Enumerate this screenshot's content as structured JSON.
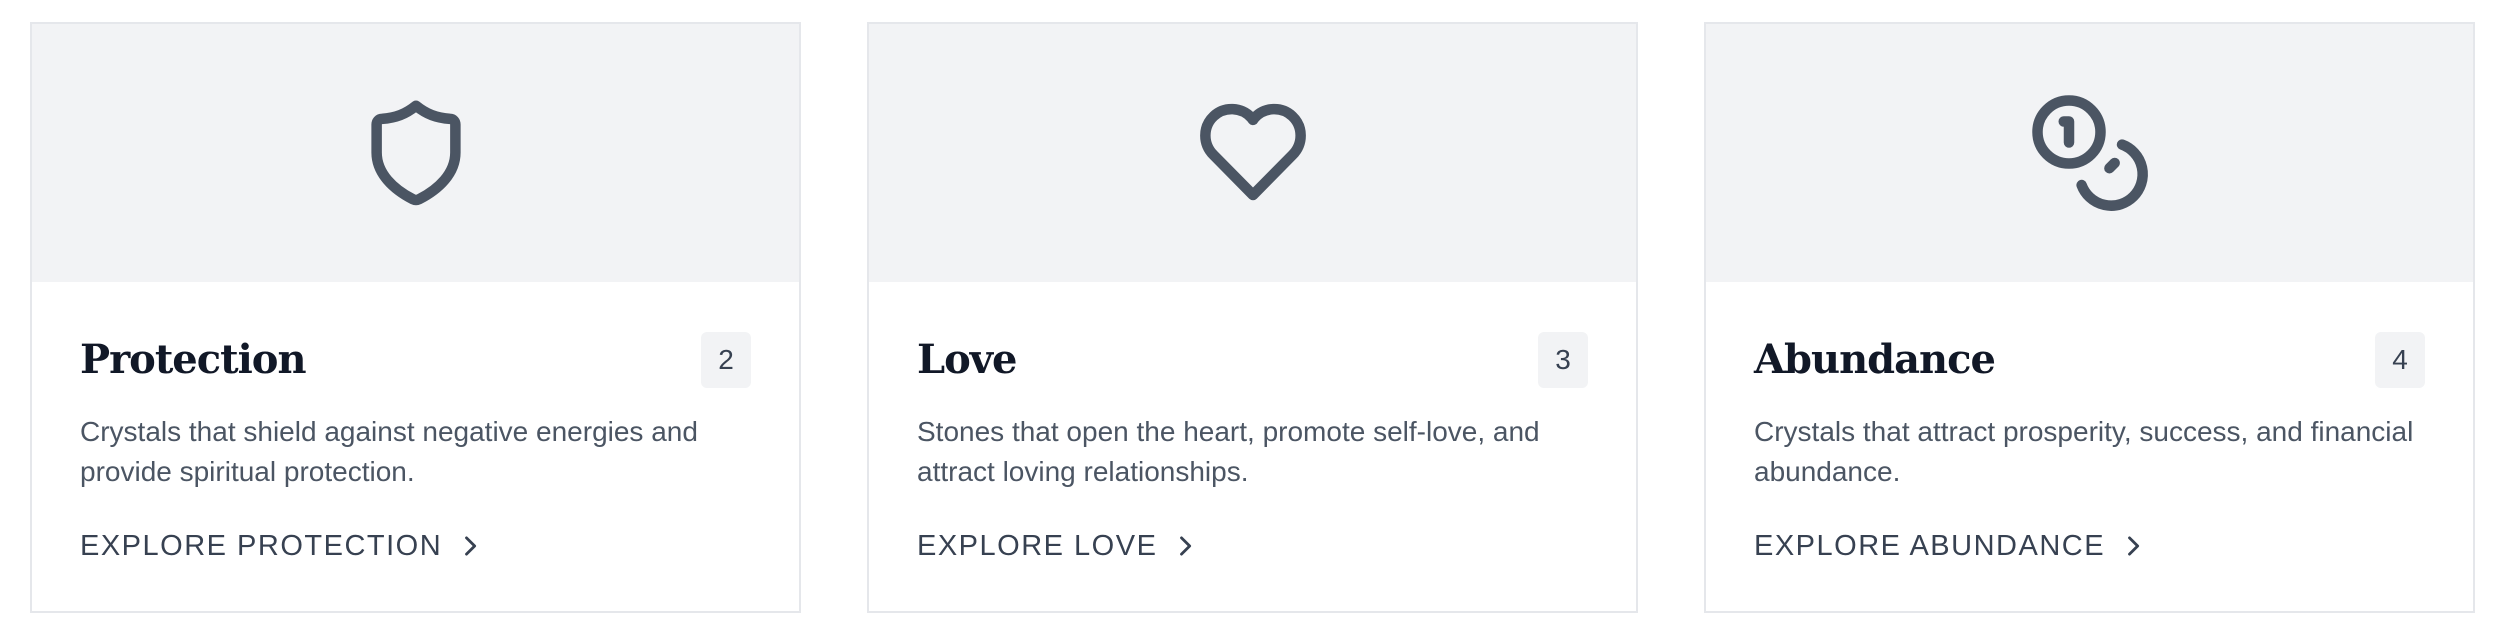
{
  "cards": [
    {
      "title": "Protection",
      "count": "2",
      "description": "Crystals that shield against negative energies and provide spiritual protection.",
      "link_label": "EXPLORE PROTECTION",
      "icon": "shield-icon"
    },
    {
      "title": "Love",
      "count": "3",
      "description": "Stones that open the heart, promote self-love, and attract loving relationships.",
      "link_label": "EXPLORE LOVE",
      "icon": "heart-icon"
    },
    {
      "title": "Abundance",
      "count": "4",
      "description": "Crystals that attract prosperity, success, and financial abundance.",
      "link_label": "EXPLORE ABUNDANCE",
      "icon": "coins-icon"
    }
  ],
  "colors": {
    "icon_stroke": "#4b5563",
    "media_bg": "#f2f3f5",
    "border": "#e5e7eb",
    "title": "#111827",
    "text": "#4b5563"
  }
}
